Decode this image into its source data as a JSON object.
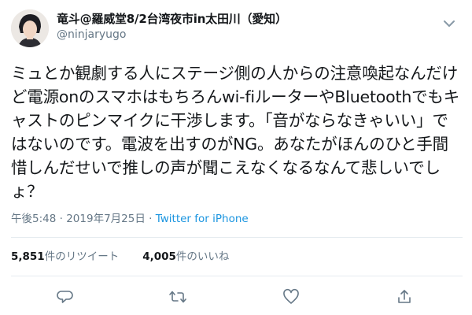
{
  "user": {
    "display_name": "竜斗@羅威堂8/2台湾夜市in太田川（愛知）",
    "handle": "@ninjaryugo"
  },
  "tweet": {
    "text": "ミュとか観劇する人にステージ側の人からの注意喚起なんだけど電源onのスマホはもちろんwi-fiルーターやBluetoothでもキャストのピンマイクに干渉します。「音がならなきゃいい」ではないのです。電波を出すのがNG。あなたがほんのひと手間惜しんだせいで推しの声が聞こえなくなるなんて悲しいでしょ？",
    "time": "午後5:48",
    "separator": "·",
    "date": "2019年7月25日",
    "separator2": "·",
    "via": "Twitter for iPhone"
  },
  "stats": {
    "retweets_count": "5,851",
    "retweets_label": "件のリツイート",
    "likes_count": "4,005",
    "likes_label": "件のいいね"
  },
  "icons": {
    "reply": "reply-icon",
    "retweet": "retweet-icon",
    "like": "heart-icon",
    "share": "share-icon",
    "more": "chevron-down-icon"
  },
  "colors": {
    "text": "#14171a",
    "secondary": "#657786",
    "link": "#1b95e0",
    "divider": "#e6ecf0"
  }
}
